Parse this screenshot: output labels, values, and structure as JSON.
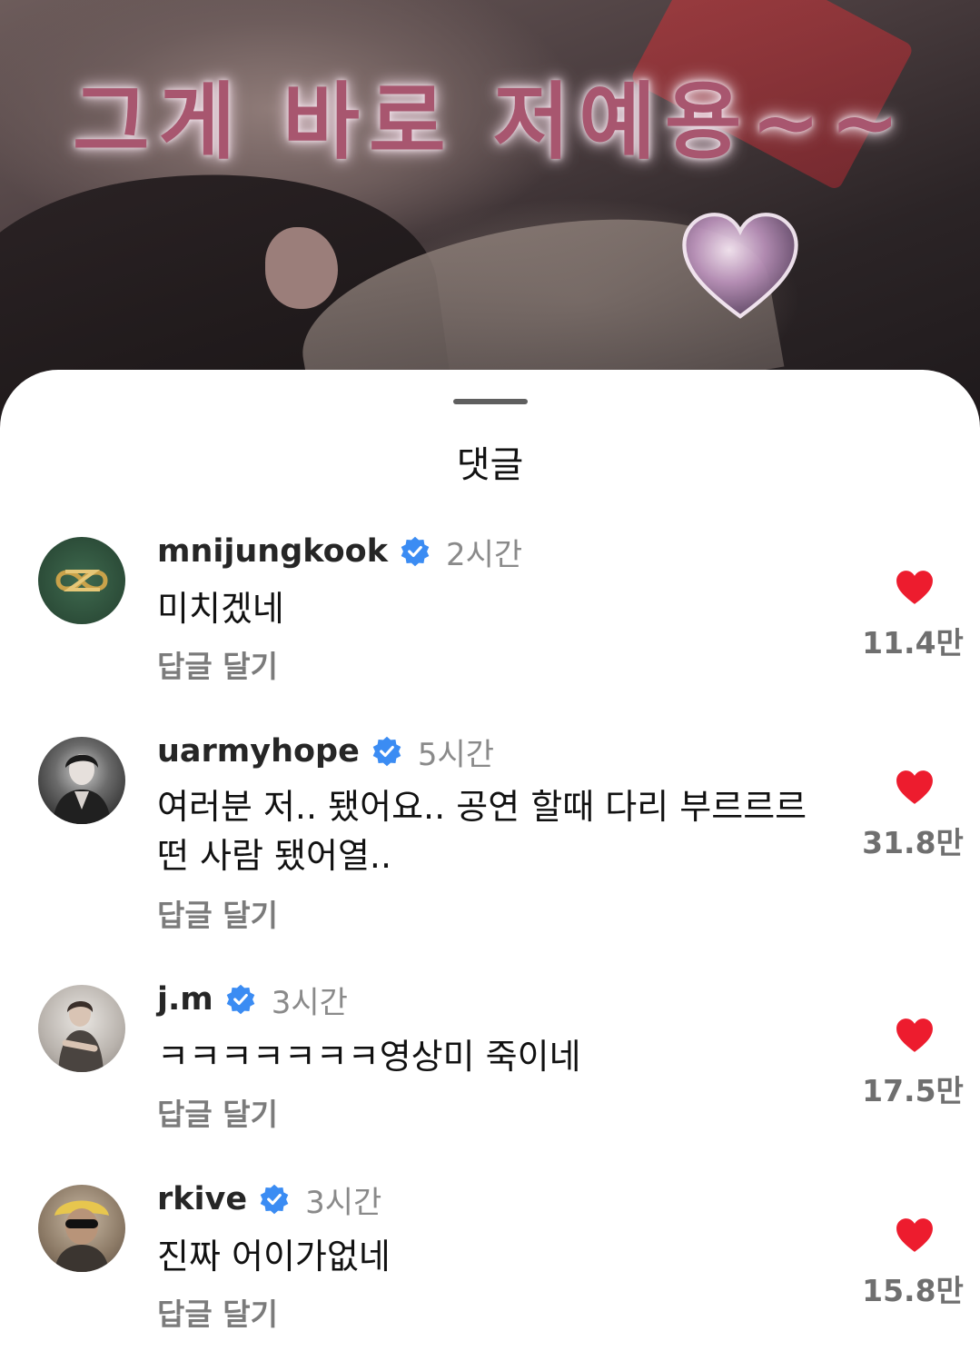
{
  "video": {
    "caption_text": "그게 바로 저예용~~"
  },
  "sheet": {
    "title": "댓글"
  },
  "colors": {
    "like_red": "#ed1c2e",
    "verified_blue": "#3b8cf3",
    "caption_pink": "#a8566f"
  },
  "comments": [
    {
      "username": "mnijungkook",
      "time": "2시간",
      "text": "미치겠네",
      "reply_label": "답글 달기",
      "likes": "11.4만",
      "avatar_icon": "gold-infinity-logo"
    },
    {
      "username": "uarmyhope",
      "time": "5시간",
      "text": "여러분 저.. 됐어요.. 공연 할때 다리 부르르르 떤 사람 됐어열..",
      "reply_label": "답글 달기",
      "likes": "31.8만",
      "avatar_icon": "person-photo"
    },
    {
      "username": "j.m",
      "time": "3시간",
      "text": "ㅋㅋㅋㅋㅋㅋㅋ영상미 죽이네",
      "reply_label": "답글 달기",
      "likes": "17.5만",
      "avatar_icon": "person-photo"
    },
    {
      "username": "rkive",
      "time": "3시간",
      "text": "진짜 어이가없네",
      "reply_label": "답글 달기",
      "likes": "15.8만",
      "avatar_icon": "person-photo"
    }
  ]
}
